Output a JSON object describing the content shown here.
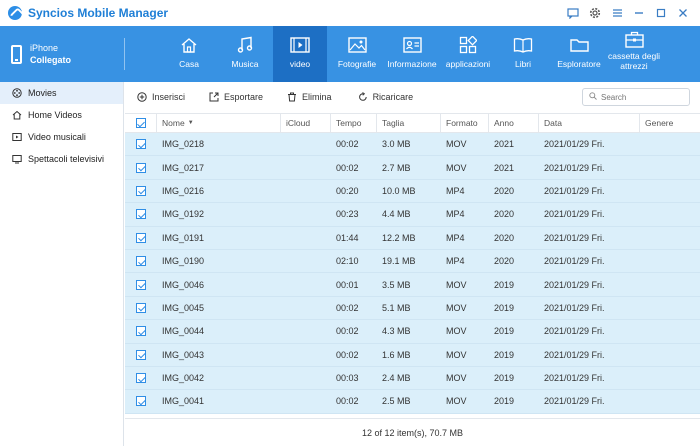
{
  "app": {
    "title": "Syncios Mobile Manager"
  },
  "device": {
    "name": "iPhone",
    "status": "Collegato"
  },
  "nav": {
    "items": [
      {
        "label": "Casa",
        "icon": "home-icon"
      },
      {
        "label": "Musica",
        "icon": "music-icon"
      },
      {
        "label": "video",
        "icon": "video-icon"
      },
      {
        "label": "Fotografie",
        "icon": "photo-icon"
      },
      {
        "label": "Informazione",
        "icon": "contact-icon"
      },
      {
        "label": "applicazioni",
        "icon": "apps-icon"
      },
      {
        "label": "Libri",
        "icon": "book-icon"
      },
      {
        "label": "Esploratore",
        "icon": "folder-icon"
      },
      {
        "label": "cassetta degli attrezzi",
        "icon": "toolbox-icon"
      }
    ]
  },
  "sidebar": {
    "items": [
      {
        "label": "Movies",
        "icon": "film-reel-icon"
      },
      {
        "label": "Home Videos",
        "icon": "home-video-icon"
      },
      {
        "label": "Video musicali",
        "icon": "music-video-icon"
      },
      {
        "label": "Spettacoli televisivi",
        "icon": "tv-icon"
      }
    ]
  },
  "toolbar": {
    "insert": "Inserisci",
    "export": "Esportare",
    "delete": "Elimina",
    "reload": "Ricaricare",
    "search_placeholder": "Search"
  },
  "table": {
    "columns": {
      "name": "Nome",
      "icloud": "iCloud",
      "time": "Tempo",
      "size": "Taglia",
      "format": "Formato",
      "year": "Anno",
      "date": "Data",
      "genre": "Genere"
    },
    "rows": [
      {
        "name": "IMG_0218",
        "icloud": "",
        "time": "00:02",
        "size": "3.0 MB",
        "format": "MOV",
        "year": "2021",
        "date": "2021/01/29 Fri.",
        "genre": ""
      },
      {
        "name": "IMG_0217",
        "icloud": "",
        "time": "00:02",
        "size": "2.7 MB",
        "format": "MOV",
        "year": "2021",
        "date": "2021/01/29 Fri.",
        "genre": ""
      },
      {
        "name": "IMG_0216",
        "icloud": "",
        "time": "00:20",
        "size": "10.0 MB",
        "format": "MP4",
        "year": "2020",
        "date": "2021/01/29 Fri.",
        "genre": ""
      },
      {
        "name": "IMG_0192",
        "icloud": "",
        "time": "00:23",
        "size": "4.4 MB",
        "format": "MP4",
        "year": "2020",
        "date": "2021/01/29 Fri.",
        "genre": ""
      },
      {
        "name": "IMG_0191",
        "icloud": "",
        "time": "01:44",
        "size": "12.2 MB",
        "format": "MP4",
        "year": "2020",
        "date": "2021/01/29 Fri.",
        "genre": ""
      },
      {
        "name": "IMG_0190",
        "icloud": "",
        "time": "02:10",
        "size": "19.1 MB",
        "format": "MP4",
        "year": "2020",
        "date": "2021/01/29 Fri.",
        "genre": ""
      },
      {
        "name": "IMG_0046",
        "icloud": "",
        "time": "00:01",
        "size": "3.5 MB",
        "format": "MOV",
        "year": "2019",
        "date": "2021/01/29 Fri.",
        "genre": ""
      },
      {
        "name": "IMG_0045",
        "icloud": "",
        "time": "00:02",
        "size": "5.1 MB",
        "format": "MOV",
        "year": "2019",
        "date": "2021/01/29 Fri.",
        "genre": ""
      },
      {
        "name": "IMG_0044",
        "icloud": "",
        "time": "00:02",
        "size": "4.3 MB",
        "format": "MOV",
        "year": "2019",
        "date": "2021/01/29 Fri.",
        "genre": ""
      },
      {
        "name": "IMG_0043",
        "icloud": "",
        "time": "00:02",
        "size": "1.6 MB",
        "format": "MOV",
        "year": "2019",
        "date": "2021/01/29 Fri.",
        "genre": ""
      },
      {
        "name": "IMG_0042",
        "icloud": "",
        "time": "00:03",
        "size": "2.4 MB",
        "format": "MOV",
        "year": "2019",
        "date": "2021/01/29 Fri.",
        "genre": ""
      },
      {
        "name": "IMG_0041",
        "icloud": "",
        "time": "00:02",
        "size": "2.5 MB",
        "format": "MOV",
        "year": "2019",
        "date": "2021/01/29 Fri.",
        "genre": ""
      }
    ]
  },
  "footer": {
    "summary": "12 of 12 item(s), 70.7 MB"
  },
  "colors": {
    "accent": "#3892e3",
    "active_nav": "#1d6fc4",
    "row_selected": "#dbeffa"
  }
}
